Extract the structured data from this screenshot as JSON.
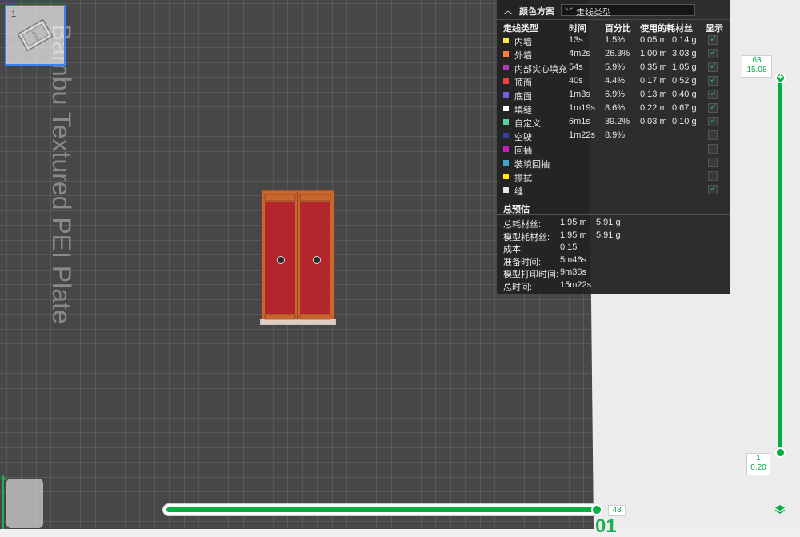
{
  "plate": {
    "label": "Bambu Textured PEI Plate",
    "number": "1"
  },
  "panel": {
    "title": "颜色方案",
    "selected_scheme": "走线类型",
    "columns": [
      "走线类型",
      "时间",
      "百分比",
      "使用的耗材丝",
      "显示"
    ],
    "rows": [
      {
        "name": "内墙",
        "color": "#ffe64d",
        "time": "13s",
        "percent": "1.5%",
        "length": "0.05 m",
        "weight": "0.14 g",
        "show": true
      },
      {
        "name": "外墙",
        "color": "#ff7d38",
        "time": "4m2s",
        "percent": "26.3%",
        "length": "1.00 m",
        "weight": "3.03 g",
        "show": true
      },
      {
        "name": "内部实心填充",
        "color": "#b03bbf",
        "time": "54s",
        "percent": "5.9%",
        "length": "0.35 m",
        "weight": "1.05 g",
        "show": true
      },
      {
        "name": "顶面",
        "color": "#f04040",
        "time": "40s",
        "percent": "4.4%",
        "length": "0.17 m",
        "weight": "0.52 g",
        "show": true
      },
      {
        "name": "底面",
        "color": "#7060e0",
        "time": "1m3s",
        "percent": "6.9%",
        "length": "0.13 m",
        "weight": "0.40 g",
        "show": true
      },
      {
        "name": "填缝",
        "color": "#ffffff",
        "time": "1m19s",
        "percent": "8.6%",
        "length": "0.22 m",
        "weight": "0.67 g",
        "show": true
      },
      {
        "name": "自定义",
        "color": "#5ed19e",
        "time": "6m1s",
        "percent": "39.2%",
        "length": "0.03 m",
        "weight": "0.10 g",
        "show": true
      },
      {
        "name": "空驶",
        "color": "#3040a8",
        "time": "1m22s",
        "percent": "8.9%",
        "length": "",
        "weight": "",
        "show": false
      },
      {
        "name": "回抽",
        "color": "#c020c0",
        "time": "",
        "percent": "",
        "length": "",
        "weight": "",
        "show": false
      },
      {
        "name": "装填回抽",
        "color": "#3aa6d0",
        "time": "",
        "percent": "",
        "length": "",
        "weight": "",
        "show": false
      },
      {
        "name": "擦拭",
        "color": "#ffea00",
        "time": "",
        "percent": "",
        "length": "",
        "weight": "",
        "show": false
      },
      {
        "name": "缝",
        "color": "#e8e8e8",
        "time": "",
        "percent": "",
        "length": "",
        "weight": "",
        "show": true
      }
    ],
    "summary_title": "总预估",
    "summary": [
      {
        "label": "总耗材丝:",
        "v1": "1.95 m",
        "v2": "5.91 g"
      },
      {
        "label": "模型耗材丝:",
        "v1": "1.95 m",
        "v2": "5.91 g"
      },
      {
        "label": "成本:",
        "v1": "0.15",
        "v2": ""
      },
      {
        "label": "准备时间:",
        "v1": "5m46s",
        "v2": ""
      },
      {
        "label": "模型打印时间:",
        "v1": "9m36s",
        "v2": ""
      },
      {
        "label": "总时间:",
        "v1": "15m22s",
        "v2": ""
      }
    ]
  },
  "layer_slider": {
    "top_layer": "63",
    "top_height": "15.08",
    "bottom_layer": "1",
    "bottom_height": "0.20"
  },
  "move_slider": {
    "value": "48"
  },
  "bottom_overlay_text": "01",
  "colors": {
    "accent": "#00ae42",
    "bed": "#4a4a4a",
    "model_top": "#b8282c",
    "model_wall": "#c85a2a"
  }
}
